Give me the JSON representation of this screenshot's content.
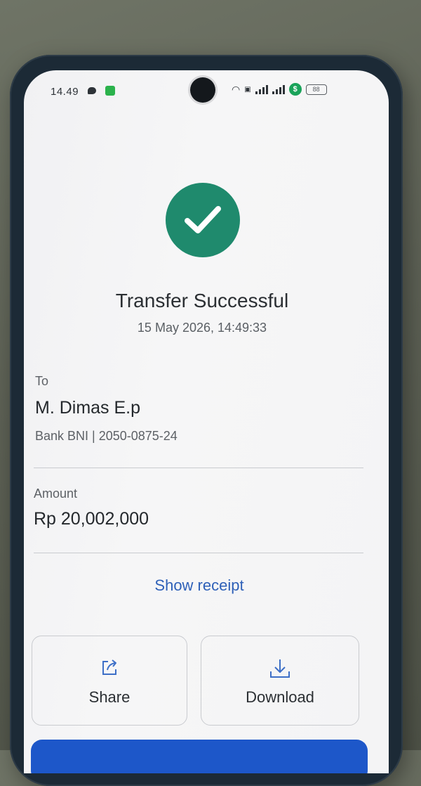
{
  "status_bar": {
    "time": "14.49",
    "battery": "88",
    "shield_glyph": "$"
  },
  "result": {
    "title": "Transfer Successful",
    "datetime": "15 May 2026, 14:49:33"
  },
  "recipient": {
    "label": "To",
    "name": "M. Dimas E.p",
    "bank_info": "Bank BNI | 2050-0875-24"
  },
  "amount": {
    "label": "Amount",
    "value": "Rp 20,002,000"
  },
  "links": {
    "show_receipt": "Show receipt"
  },
  "actions": {
    "share_label": "Share",
    "download_label": "Download"
  },
  "colors": {
    "success": "#1f8a6d",
    "link": "#2f61b8",
    "primary": "#1d57c9"
  }
}
